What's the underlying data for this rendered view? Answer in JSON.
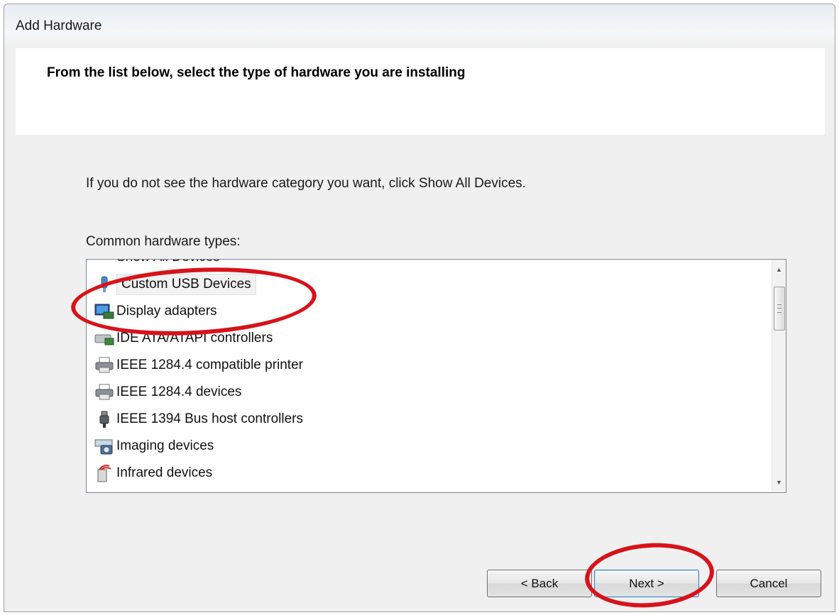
{
  "window": {
    "title": "Add Hardware"
  },
  "header": {
    "instruction": "From the list below, select the type of hardware you are installing"
  },
  "body": {
    "hint": "If you do not see the hardware category you want, click Show All Devices.",
    "list_label": "Common hardware types:",
    "items": [
      {
        "label": "Show All Devices",
        "icon": "show-all-devices-icon"
      },
      {
        "label": "Custom USB Devices",
        "icon": "usb-device-icon"
      },
      {
        "label": "Display adapters",
        "icon": "display-adapter-icon"
      },
      {
        "label": "IDE ATA/ATAPI controllers",
        "icon": "ide-controller-icon"
      },
      {
        "label": "IEEE 1284.4 compatible printer",
        "icon": "printer-icon"
      },
      {
        "label": "IEEE 1284.4 devices",
        "icon": "printer-icon"
      },
      {
        "label": "IEEE 1394 Bus host controllers",
        "icon": "firewire-plug-icon"
      },
      {
        "label": "Imaging devices",
        "icon": "imaging-device-icon"
      },
      {
        "label": "Infrared devices",
        "icon": "infrared-device-icon"
      }
    ],
    "selected_item": "Custom USB Devices"
  },
  "buttons": {
    "back": "< Back",
    "next": "Next >",
    "cancel": "Cancel"
  },
  "colors": {
    "annotation": "#d8121a",
    "selection": "#f2f2f2"
  }
}
